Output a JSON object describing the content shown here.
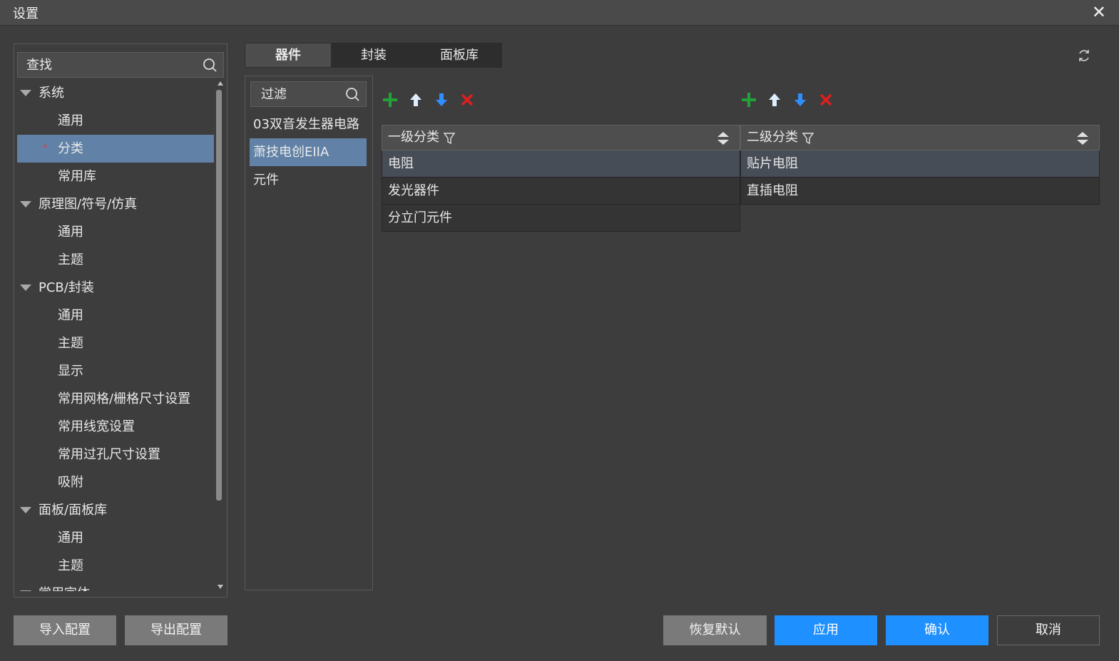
{
  "window": {
    "title": "设置"
  },
  "left_panel": {
    "search_placeholder": "查找",
    "tree": [
      {
        "type": "group",
        "label": "系统"
      },
      {
        "type": "leaf",
        "label": "通用"
      },
      {
        "type": "leaf",
        "label": "分类",
        "selected": true,
        "modified_mark": "*"
      },
      {
        "type": "leaf",
        "label": "常用库"
      },
      {
        "type": "group",
        "label": "原理图/符号/仿真"
      },
      {
        "type": "leaf",
        "label": "通用"
      },
      {
        "type": "leaf",
        "label": "主题"
      },
      {
        "type": "group",
        "label": "PCB/封装"
      },
      {
        "type": "leaf",
        "label": "通用"
      },
      {
        "type": "leaf",
        "label": "主题"
      },
      {
        "type": "leaf",
        "label": "显示"
      },
      {
        "type": "leaf",
        "label": "常用网格/栅格尺寸设置"
      },
      {
        "type": "leaf",
        "label": "常用线宽设置"
      },
      {
        "type": "leaf",
        "label": "常用过孔尺寸设置"
      },
      {
        "type": "leaf",
        "label": "吸附"
      },
      {
        "type": "group",
        "label": "面板/面板库"
      },
      {
        "type": "leaf",
        "label": "通用"
      },
      {
        "type": "leaf",
        "label": "主题"
      },
      {
        "type": "group",
        "label": "常用字体"
      }
    ]
  },
  "tabs": [
    {
      "label": "器件",
      "active": true
    },
    {
      "label": "封装",
      "active": false
    },
    {
      "label": "面板库",
      "active": false
    }
  ],
  "filter": {
    "placeholder": "过滤",
    "items": [
      {
        "label": "03双音发生器电路",
        "selected": false
      },
      {
        "label": "萧技电创EIIA",
        "selected": true
      },
      {
        "label": "元件",
        "selected": false
      }
    ]
  },
  "primary": {
    "header": "一级分类",
    "rows": [
      {
        "label": "电阻",
        "selected": true
      },
      {
        "label": "发光器件",
        "selected": false
      },
      {
        "label": "分立门元件",
        "selected": false
      }
    ]
  },
  "secondary": {
    "header": "二级分类",
    "rows": [
      {
        "label": "贴片电阻",
        "selected": true
      },
      {
        "label": "直插电阻",
        "selected": false
      }
    ]
  },
  "footer": {
    "import_label": "导入配置",
    "export_label": "导出配置",
    "restore_label": "恢复默认",
    "apply_label": "应用",
    "confirm_label": "确认",
    "cancel_label": "取消"
  },
  "colors": {
    "selection": "#6182a6",
    "primary_button": "#1e90ff",
    "add_icon": "#22a33a",
    "move_up_icon": "#ddeeff",
    "move_down_icon": "#2f8fff",
    "delete_icon": "#e01e1e"
  }
}
